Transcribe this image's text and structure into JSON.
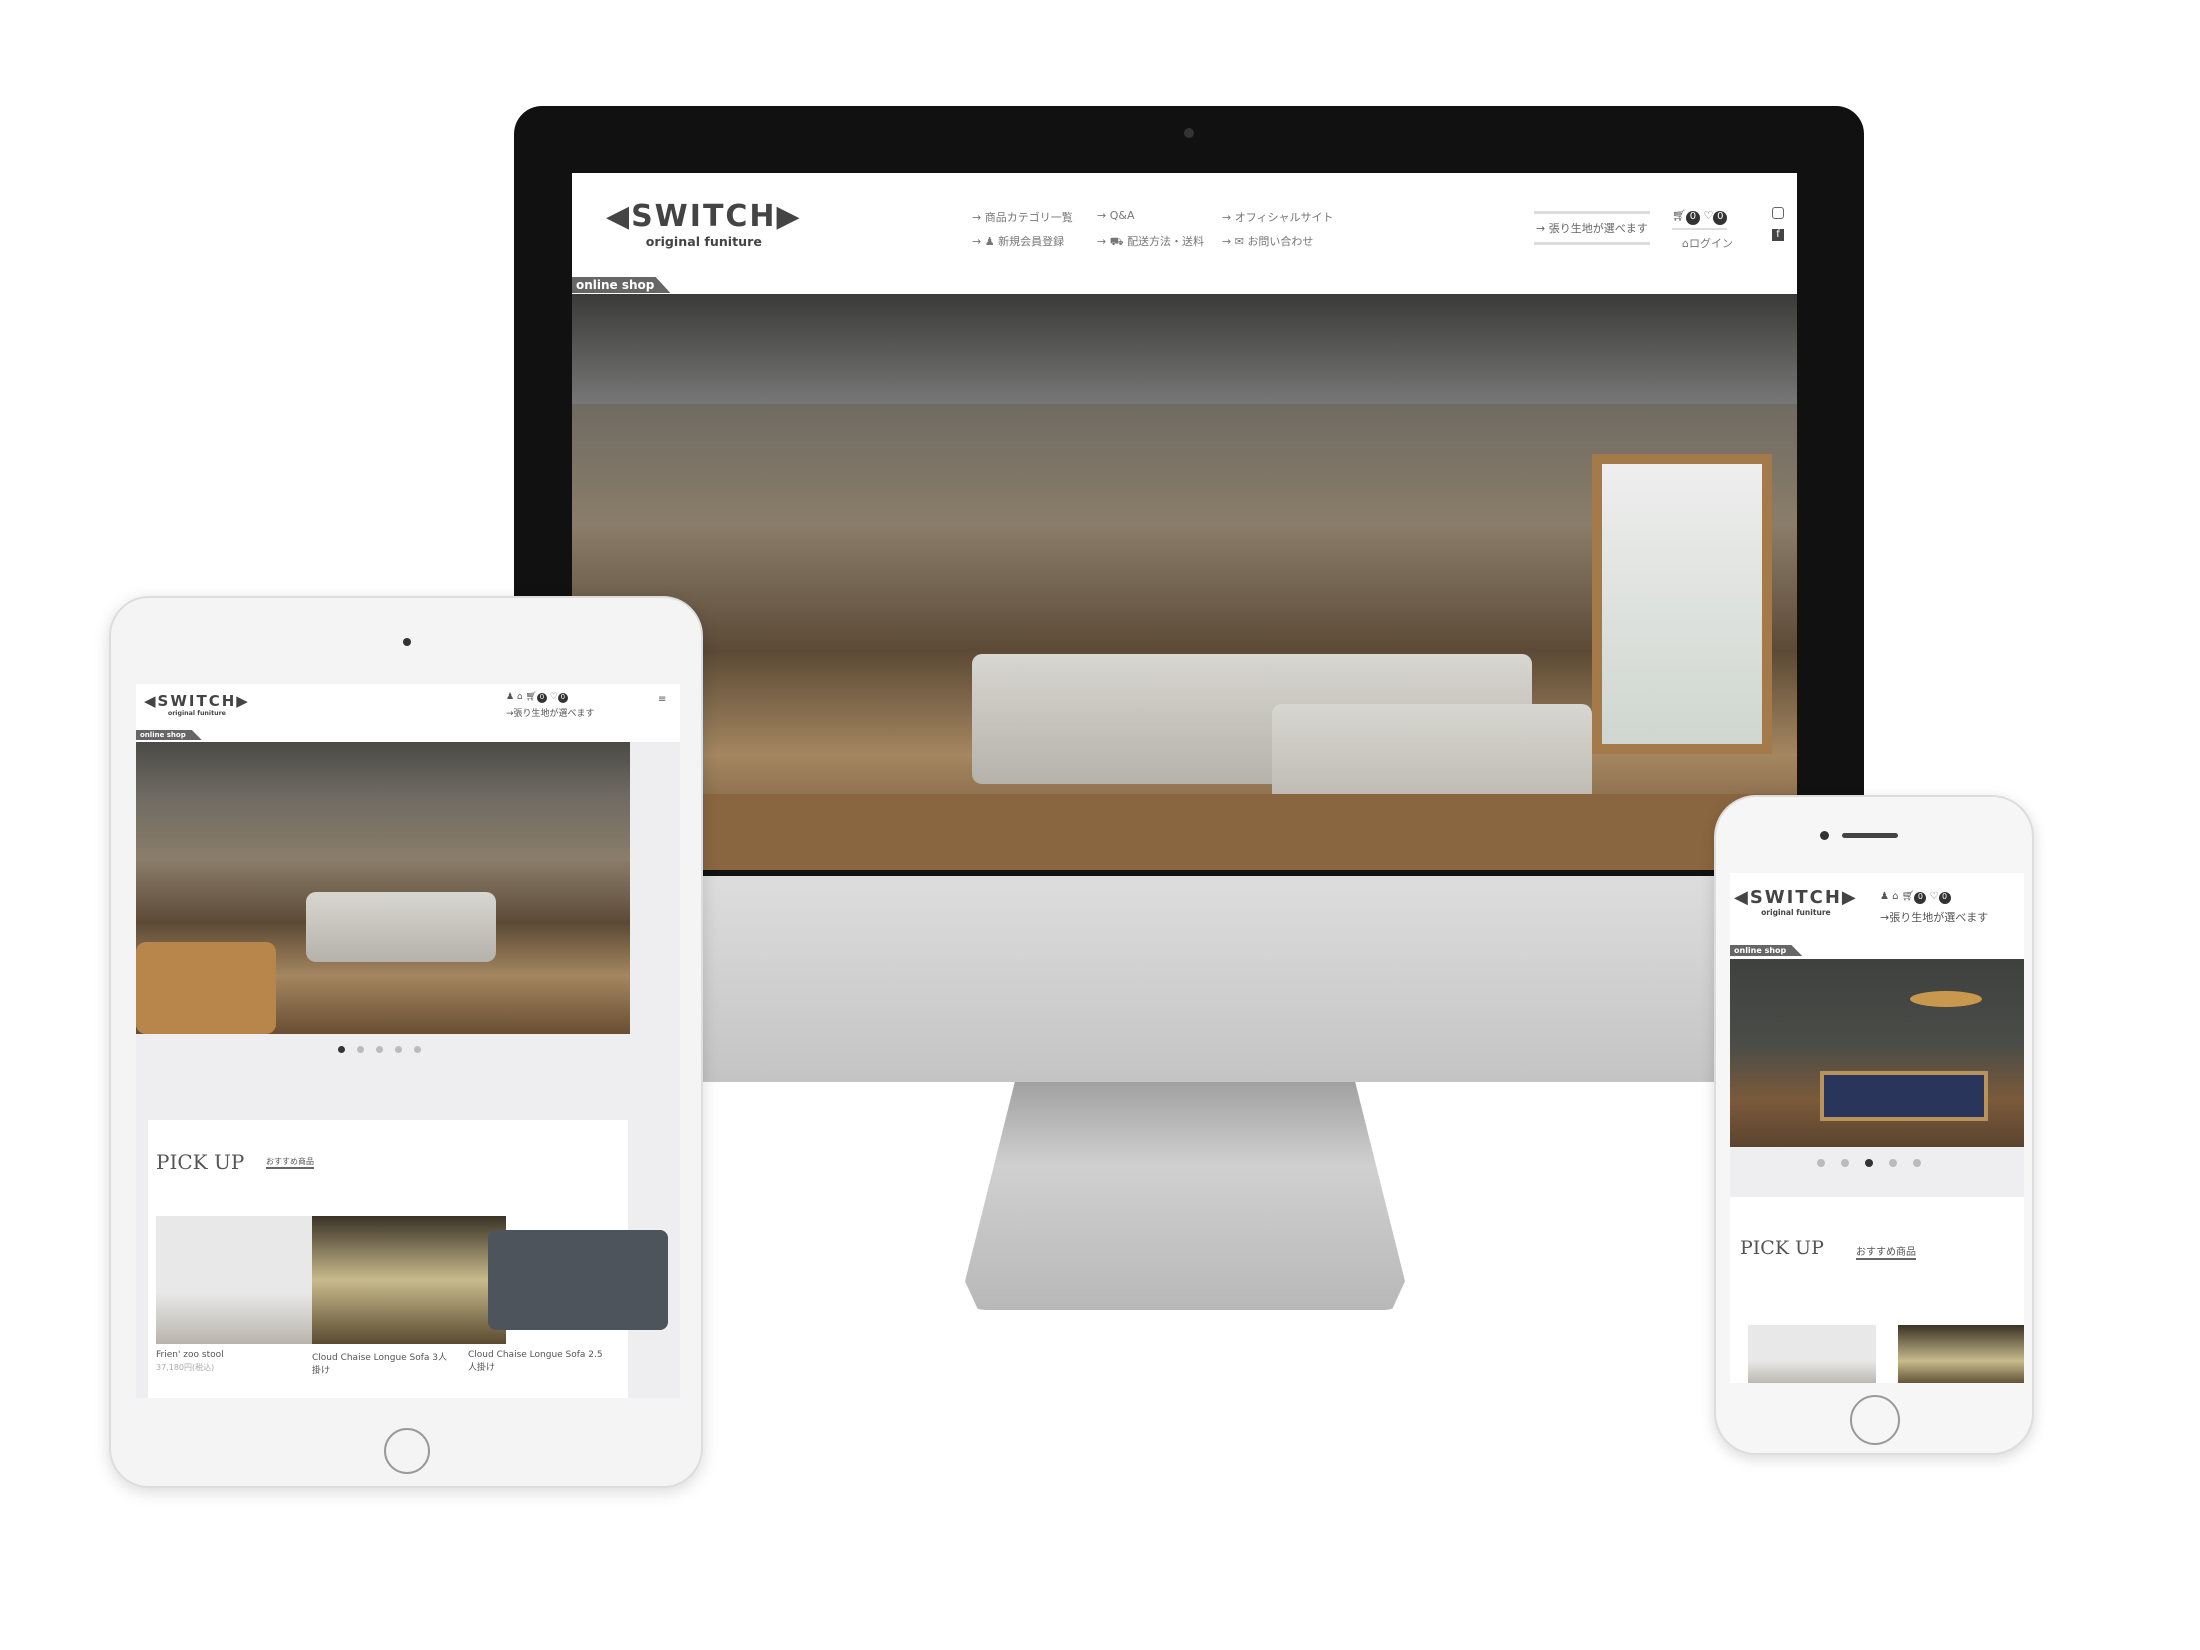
{
  "brand": {
    "name": "SWITCH",
    "tagline": "original funiture",
    "shop_tag": "online shop",
    "registered": "®"
  },
  "desktop": {
    "nav": [
      {
        "label": "商品カテゴリ一覧",
        "icon": "arrow-right-icon"
      },
      {
        "label": "Q&A",
        "icon": "arrow-right-icon"
      },
      {
        "label": "オフィシャルサイト",
        "icon": "arrow-right-icon"
      },
      {
        "label": "新規会員登録",
        "icon": "user-icon"
      },
      {
        "label": "配送方法・送料",
        "icon": "truck-icon"
      },
      {
        "label": "お問い合わせ",
        "icon": "mail-icon"
      }
    ],
    "fabric_link": "張り生地が選べます",
    "cart_count": "0",
    "wishlist_count": "0",
    "login": "ログイン"
  },
  "tablet": {
    "fabric_link": "張り生地が選べます",
    "cart_count": "0",
    "wishlist_count": "0",
    "slide_active": 0,
    "slide_count": 5,
    "pickup": {
      "title": "PICK UP",
      "subtitle": "おすすめ商品",
      "products": [
        {
          "name": "Frien' zoo stool",
          "price": "37,180円(税込)"
        },
        {
          "name": "Cloud Chaise Longue Sofa 3人掛け",
          "price": ""
        },
        {
          "name": "Cloud Chaise Longue Sofa 2.5人掛け",
          "price": ""
        }
      ]
    }
  },
  "phone": {
    "fabric_link": "張り生地が選べます",
    "cart_count": "0",
    "wishlist_count": "0",
    "slide_active": 2,
    "slide_count": 5,
    "pickup": {
      "title": "PICK UP",
      "subtitle": "おすすめ商品"
    }
  },
  "colors": {
    "bezel": "#111111",
    "silver": "#c8c8c8",
    "text": "#555555",
    "badge": "#333333"
  }
}
